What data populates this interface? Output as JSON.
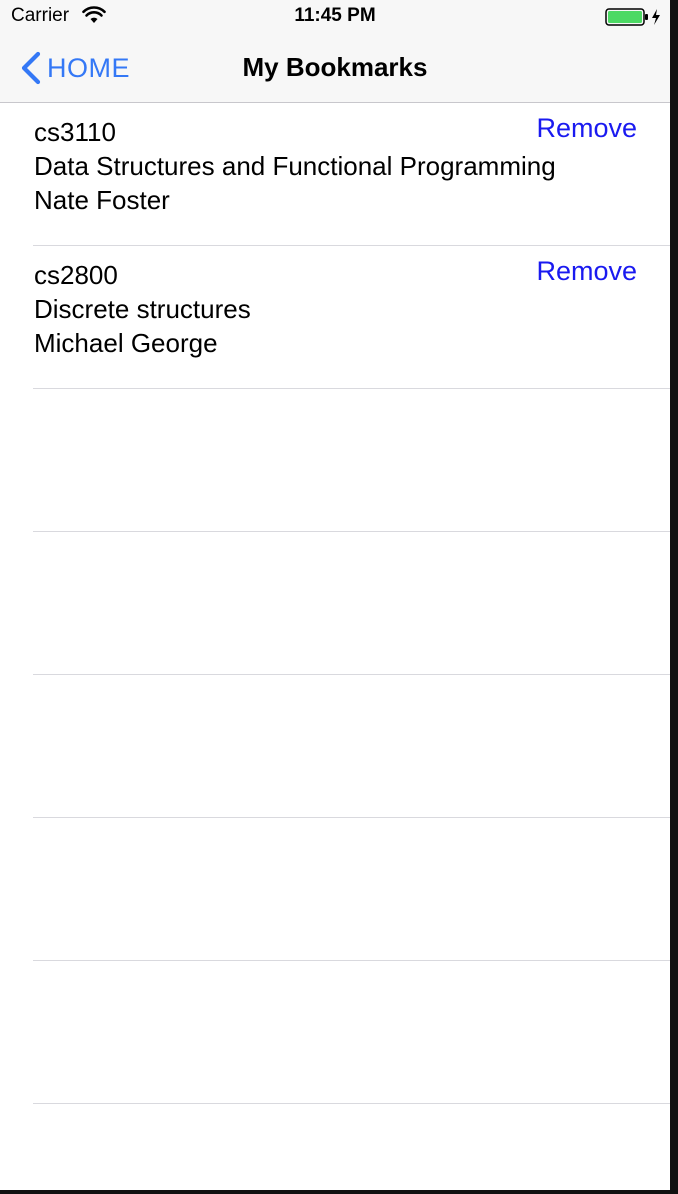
{
  "status_bar": {
    "carrier": "Carrier",
    "time": "11:45 PM",
    "wifi_icon": "wifi-icon",
    "battery_icon": "battery-charging-icon"
  },
  "nav": {
    "back_label": "HOME",
    "title": "My Bookmarks",
    "accent_color": "#3478f6"
  },
  "bookmarks": [
    {
      "code": "cs3110",
      "title": "Data Structures and Functional Programming",
      "instructor": "Nate Foster",
      "remove_label": "Remove"
    },
    {
      "code": "cs2800",
      "title": "Discrete structures",
      "instructor": "Michael George",
      "remove_label": "Remove"
    }
  ],
  "colors": {
    "remove": "#1a1af0",
    "separator": "#d9d9de"
  }
}
